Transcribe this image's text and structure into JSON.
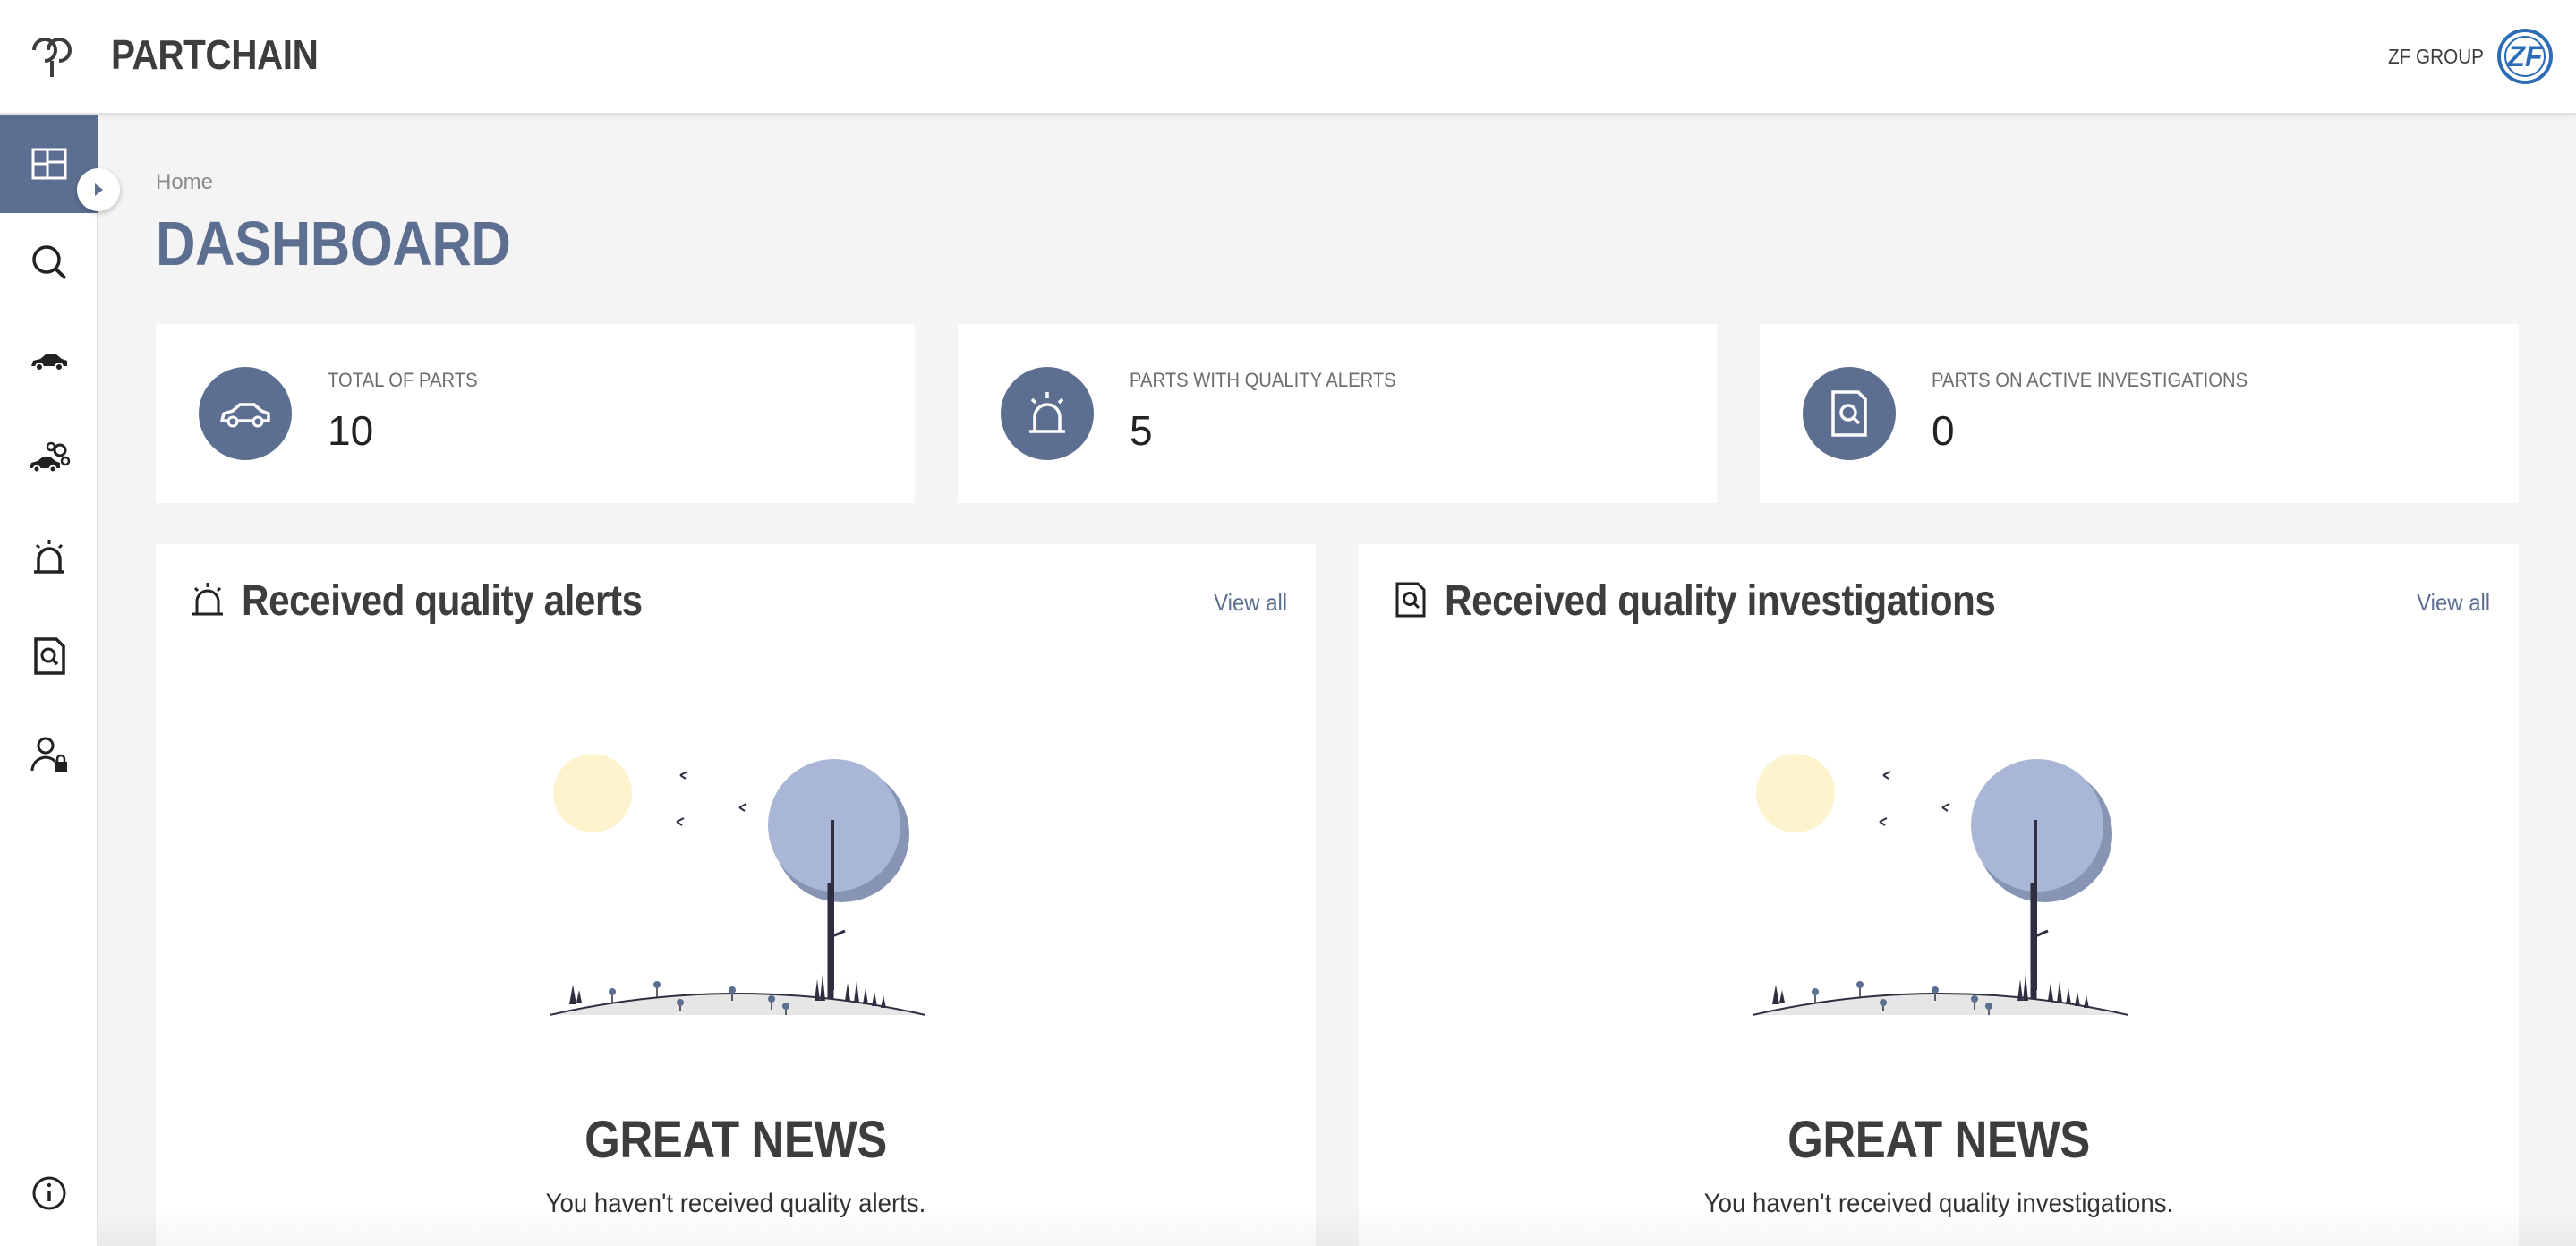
{
  "header": {
    "app_title": "PARTCHAIN",
    "company": "ZF GROUP",
    "company_logo_text": "ZF",
    "logo_icon": "partchain-logo-icon"
  },
  "sidebar": {
    "items": [
      {
        "icon": "dashboard-icon",
        "active": true
      },
      {
        "icon": "search-icon",
        "active": false
      },
      {
        "icon": "car-icon",
        "active": false
      },
      {
        "icon": "car-parts-icon",
        "active": false
      },
      {
        "icon": "siren-icon",
        "active": false
      },
      {
        "icon": "document-search-icon",
        "active": false
      },
      {
        "icon": "user-admin-icon",
        "active": false
      }
    ],
    "bottom_icon": "info-icon",
    "toggle_icon": "chevron-right-icon"
  },
  "breadcrumb": "Home",
  "page_title": "DASHBOARD",
  "stats": [
    {
      "label": "TOTAL OF PARTS",
      "value": "10",
      "icon": "car-icon"
    },
    {
      "label": "PARTS WITH QUALITY ALERTS",
      "value": "5",
      "icon": "siren-icon"
    },
    {
      "label": "PARTS ON ACTIVE INVESTIGATIONS",
      "value": "0",
      "icon": "document-search-icon"
    }
  ],
  "panels": [
    {
      "title": "Received quality alerts",
      "icon": "siren-icon",
      "view_all": "View all",
      "empty_title": "GREAT NEWS",
      "empty_message": "You haven't received quality alerts."
    },
    {
      "title": "Received quality investigations",
      "icon": "document-search-icon",
      "view_all": "View all",
      "empty_title": "GREAT NEWS",
      "empty_message": "You haven't received quality investigations."
    }
  ],
  "colors": {
    "accent": "#5c6f91",
    "sun": "#fdf4cf",
    "tree": "#a9b6d6",
    "tree_shadow": "#8795b3",
    "trunk": "#2f2e41",
    "ground": "#e6e6e6"
  }
}
